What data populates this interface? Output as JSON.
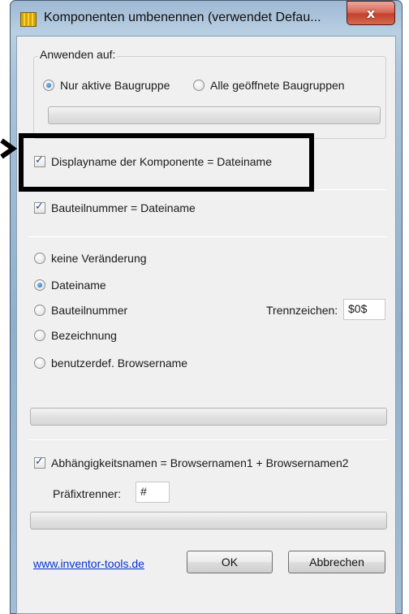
{
  "window": {
    "title": "Komponenten umbenennen (verwendet Defau...",
    "close_glyph": "x"
  },
  "apply_group": {
    "legend": "Anwenden auf:",
    "options": [
      {
        "label": "Nur aktive Baugruppe",
        "checked": true
      },
      {
        "label": "Alle geöffnete Baugruppen",
        "checked": false
      }
    ]
  },
  "checks": {
    "display_name": {
      "label": "Displayname der Komponente = Dateiname",
      "checked": true
    },
    "part_number": {
      "label": "Bauteilnummer = Dateiname",
      "checked": true
    },
    "dependency": {
      "label": "Abhängigkeitsnamen = Browsernamen1 + Browsernamen2",
      "checked": true
    }
  },
  "browser_name": {
    "options": [
      {
        "label": "keine Veränderung",
        "checked": false
      },
      {
        "label": "Dateiname",
        "checked": true
      },
      {
        "label": "Bauteilnummer",
        "checked": false
      },
      {
        "label": "Bezeichnung",
        "checked": false
      },
      {
        "label": "benutzerdef. Browsername",
        "checked": false
      }
    ],
    "separator_label": "Trennzeichen:",
    "separator_value": "$0$"
  },
  "prefix": {
    "label": "Präfixtrenner:",
    "value": "#"
  },
  "footer": {
    "link": "www.inventor-tools.de",
    "ok_label": "OK",
    "cancel_label": "Abbrechen"
  },
  "colors": {
    "highlight_border": "#000000",
    "link": "#0033cc",
    "close_button": "#c4412c"
  }
}
